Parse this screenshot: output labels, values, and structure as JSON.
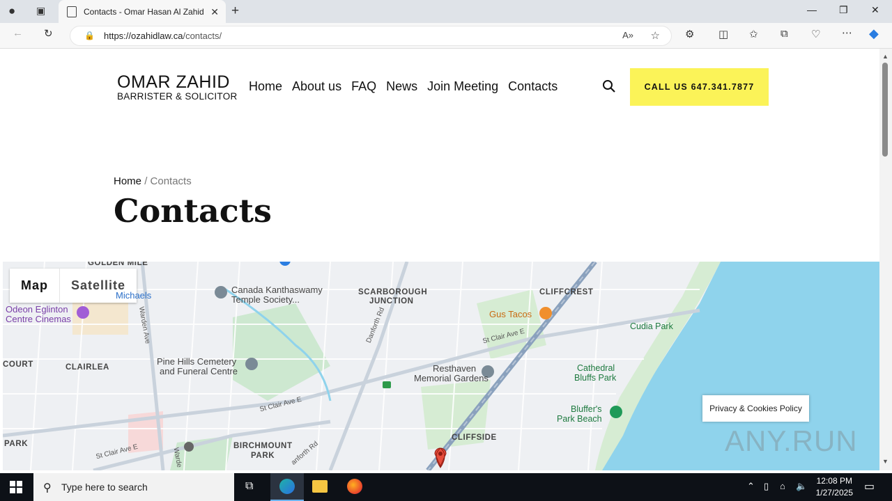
{
  "browser": {
    "tab_title": "Contacts - Omar Hasan Al Zahid",
    "url_host": "https://ozahidlaw.ca",
    "url_path": "/contacts/"
  },
  "site": {
    "logo_line1": "OMAR ZAHID",
    "logo_line2": "BARRISTER & SOLICITOR",
    "nav": [
      "Home",
      "About us",
      "FAQ",
      "News",
      "Join Meeting",
      "Contacts"
    ],
    "call_button": "CALL US 647.341.7877"
  },
  "breadcrumb": {
    "home": "Home",
    "separator": "/",
    "current": "Contacts"
  },
  "page_title": "Contacts",
  "map": {
    "tab_map": "Map",
    "tab_satellite": "Satellite",
    "labels": {
      "golden_mile": "GOLDEN MILE",
      "odeon1": "Odeon Eglinton",
      "odeon2": "Centre Cinemas",
      "michaels": "Michaels",
      "kanthaswamy1": "Canada Kanthaswamy",
      "kanthaswamy2": "Temple Society...",
      "scarborough1": "SCARBOROUGH",
      "scarborough2": "JUNCTION",
      "cliffcrest": "CLIFFCREST",
      "gus_tacos": "Gus Tacos",
      "cudia_park": "Cudia Park",
      "clairlea": "CLAIRLEA",
      "court": "COURT",
      "pine_hills1": "Pine Hills Cemetery",
      "pine_hills2": "and Funeral Centre",
      "resthaven1": "Resthaven",
      "resthaven2": "Memorial Gardens",
      "cathedral1": "Cathedral",
      "cathedral2": "Bluffs Park",
      "bluffers1": "Bluffer's",
      "bluffers2": "Park Beach",
      "cliffside": "CLIFFSIDE",
      "birchmount1": "BIRCHMOUNT",
      "birchmount2": "PARK",
      "park": "PARK",
      "st_clair1": "St Clair Ave E",
      "st_clair2": "St Clair Ave E",
      "st_clair3": "St Clair Ave E",
      "danforth1": "Danforth Rd",
      "danforth2": "anforth Rd",
      "warden1": "Warden Ave",
      "warden2": "Warde"
    },
    "privacy": "Privacy & Cookies Policy"
  },
  "taskbar": {
    "search_placeholder": "Type here to search",
    "time": "12:08 PM",
    "date": "1/27/2025"
  },
  "watermark": "ANY.RUN"
}
